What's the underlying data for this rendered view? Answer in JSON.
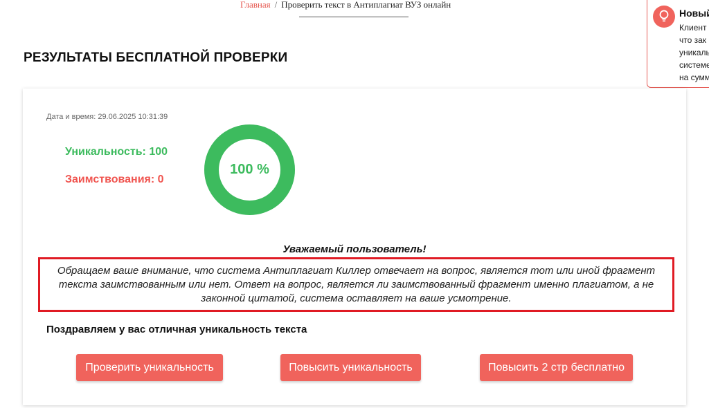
{
  "breadcrumb": {
    "home": "Главная",
    "separator": "/",
    "current": "Проверить текст в Антиплагиат ВУЗ онлайн"
  },
  "page_title": "РЕЗУЛЬТАТЫ БЕСПЛАТНОЙ ПРОВЕРКИ",
  "toast": {
    "icon": "lightbulb-icon",
    "title": "Новый",
    "lines": [
      "Клиент",
      "что зак",
      "уникалы",
      "системе",
      "на сумм"
    ]
  },
  "result": {
    "datetime": "Дата и время: 29.06.2025 10:31:39",
    "uniqueness": "Уникальность: 100",
    "borrowing": "Заимствования: 0",
    "percent": 100,
    "percent_label": "100 %"
  },
  "notice": {
    "heading": "Уважаемый пользователь!",
    "text": "Обращаем ваше внимание, что система Антиплагиат Киллер отвечает на вопрос, является тот или иной фрагмент текста заимствованным или нет. Ответ на вопрос, является ли заимствованный фрагмент именно плагиатом, а не законной цитатой, система оставляет на ваше усмотрение."
  },
  "congrats": "Поздравляем у вас отличная уникальность текста",
  "buttons": {
    "check": "Проверить уникальность",
    "raise": "Повысить уникальность",
    "free": "Повысить 2 стр бесплатно"
  },
  "colors": {
    "accent": "#f0635c",
    "success": "#3dbb5e",
    "danger": "#f0544f",
    "notice_border": "#e01b24"
  }
}
